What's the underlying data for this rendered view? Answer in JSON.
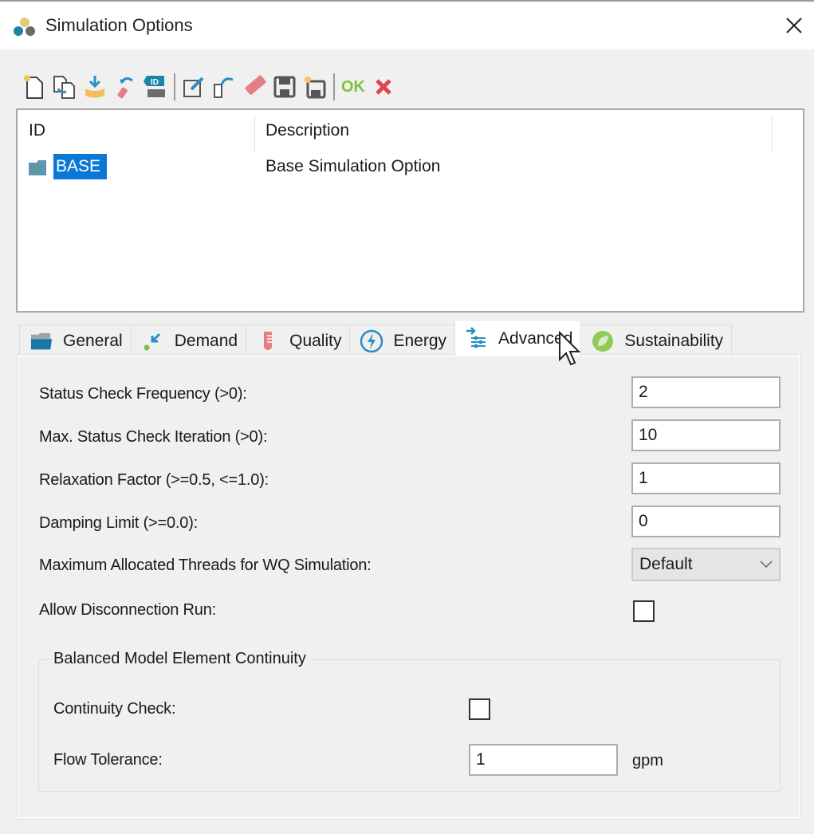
{
  "window": {
    "title": "Simulation Options",
    "app_icon": "app-logo-icon",
    "close_icon": "close-icon"
  },
  "toolbar": {
    "buttons": [
      {
        "name": "new",
        "icon": "new-document-icon"
      },
      {
        "name": "duplicate",
        "icon": "duplicate-icon"
      },
      {
        "name": "import",
        "icon": "import-icon"
      },
      {
        "name": "undo-change",
        "icon": "undo-erase-icon"
      },
      {
        "name": "id-label",
        "icon": "id-tag-icon"
      },
      {
        "name": "edit",
        "icon": "edit-icon"
      },
      {
        "name": "revert",
        "icon": "revert-icon"
      },
      {
        "name": "delete",
        "icon": "eraser-icon"
      },
      {
        "name": "save",
        "icon": "save-icon"
      },
      {
        "name": "save-as",
        "icon": "save-as-icon"
      }
    ],
    "ok_label": "OK",
    "cancel_icon": "cancel-x-icon"
  },
  "list": {
    "columns": [
      "ID",
      "Description"
    ],
    "rows": [
      {
        "id": "BASE",
        "description": "Base Simulation Option",
        "selected": true
      }
    ]
  },
  "tabs": [
    {
      "label": "General",
      "icon": "folder-icon",
      "active": false
    },
    {
      "label": "Demand",
      "icon": "demand-arrow-icon",
      "active": false
    },
    {
      "label": "Quality",
      "icon": "test-tube-icon",
      "active": false
    },
    {
      "label": "Energy",
      "icon": "energy-bolt-icon",
      "active": false
    },
    {
      "label": "Advanced",
      "icon": "advanced-sliders-icon",
      "active": true
    },
    {
      "label": "Sustainability",
      "icon": "leaf-icon",
      "active": false
    }
  ],
  "advanced": {
    "status_check_frequency": {
      "label": "Status Check Frequency (>0):",
      "value": "2"
    },
    "max_status_check_iteration": {
      "label": "Max. Status Check Iteration (>0):",
      "value": "10"
    },
    "relaxation_factor": {
      "label": "Relaxation Factor (>=0.5, <=1.0):",
      "value": "1"
    },
    "damping_limit": {
      "label": "Damping Limit (>=0.0):",
      "value": "0"
    },
    "max_threads": {
      "label": "Maximum Allocated Threads for WQ Simulation:",
      "value": "Default"
    },
    "allow_disconnection_run": {
      "label": "Allow Disconnection Run:",
      "checked": false
    },
    "continuity_group": {
      "title": "Balanced Model Element Continuity",
      "continuity_check": {
        "label": "Continuity Check:",
        "checked": false
      },
      "flow_tolerance": {
        "label": "Flow Tolerance:",
        "value": "1",
        "unit": "gpm"
      }
    }
  },
  "colors": {
    "selection": "#0a78d7",
    "ok_green": "#7cc242",
    "cancel_red": "#e0474c"
  }
}
